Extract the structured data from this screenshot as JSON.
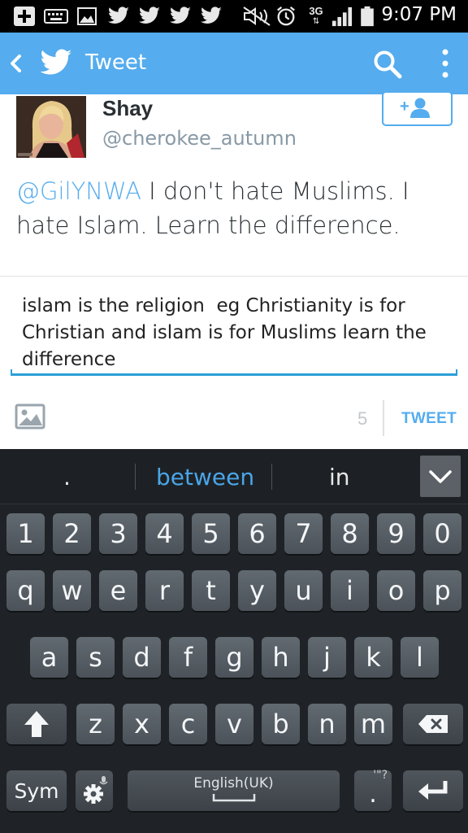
{
  "status_bar": {
    "time": "9:07 PM",
    "network": "3G",
    "icons": [
      "plus-box-icon",
      "keyboard-icon",
      "image-icon",
      "twitter-icon",
      "twitter-icon",
      "twitter-icon",
      "twitter-icon",
      "mute-icon",
      "alarm-icon",
      "network-3g-icon",
      "signal-icon",
      "battery-icon"
    ]
  },
  "action_bar": {
    "title": "Tweet",
    "back_icon": "chevron-left-icon",
    "logo_icon": "twitter-bird-icon",
    "search_icon": "search-icon",
    "overflow_icon": "more-vert-icon",
    "color": "#55acee"
  },
  "tweet": {
    "author_name": "Shay",
    "author_handle": "@cherokee_autumn",
    "mention": "@GilYNWA",
    "text": " I don't hate Muslims. I hate Islam. Learn the difference.",
    "follow_icon": "follow-plus-icon"
  },
  "composer": {
    "reply_text": "islam is the religion  eg Christianity is for Christian and islam is for Muslims learn the difference",
    "char_count": "5",
    "tweet_button": "TWEET",
    "media_icon": "image-icon"
  },
  "keyboard": {
    "suggestions": [
      ".",
      "between",
      "in"
    ],
    "suggestion_highlight": "#4aa5e8",
    "row_numbers": [
      "1",
      "2",
      "3",
      "4",
      "5",
      "6",
      "7",
      "8",
      "9",
      "0"
    ],
    "row_top": [
      "q",
      "w",
      "e",
      "r",
      "t",
      "y",
      "u",
      "i",
      "o",
      "p"
    ],
    "row_middle": [
      "a",
      "s",
      "d",
      "f",
      "g",
      "h",
      "j",
      "k",
      "l"
    ],
    "row_bottom": [
      "z",
      "x",
      "c",
      "v",
      "b",
      "n",
      "m"
    ],
    "sym_label": "Sym",
    "space_label": "English(UK)",
    "punct_label": ".",
    "punct_hint": "'\"?"
  }
}
